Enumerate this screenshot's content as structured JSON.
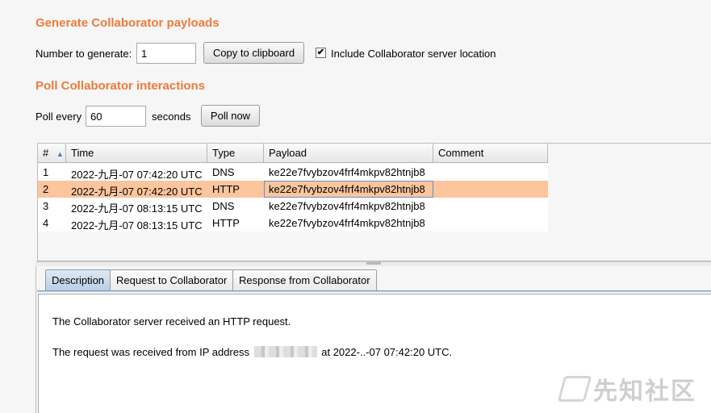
{
  "generate": {
    "heading": "Generate Collaborator payloads",
    "number_label": "Number to generate:",
    "number_value": "1",
    "copy_button": "Copy to clipboard",
    "include_label": "Include Collaborator server location",
    "include_checked": true
  },
  "poll": {
    "heading": "Poll Collaborator interactions",
    "poll_every_label": "Poll every",
    "poll_value": "60",
    "seconds_label": "seconds",
    "poll_now_button": "Poll now"
  },
  "table": {
    "columns": [
      "#",
      "Time",
      "Type",
      "Payload",
      "Comment"
    ],
    "sort_indicator": "▲",
    "rows": [
      {
        "num": "1",
        "time": "2022-九月-07 07:42:20 UTC",
        "type": "DNS",
        "payload": "ke22e7fvybzov4frf4mkpv82htnjb8",
        "comment": ""
      },
      {
        "num": "2",
        "time": "2022-九月-07 07:42:20 UTC",
        "type": "HTTP",
        "payload": "ke22e7fvybzov4frf4mkpv82htnjb8",
        "comment": ""
      },
      {
        "num": "3",
        "time": "2022-九月-07 08:13:15 UTC",
        "type": "DNS",
        "payload": "ke22e7fvybzov4frf4mkpv82htnjb8",
        "comment": ""
      },
      {
        "num": "4",
        "time": "2022-九月-07 08:13:15 UTC",
        "type": "HTTP",
        "payload": "ke22e7fvybzov4frf4mkpv82htnjb8",
        "comment": ""
      }
    ],
    "selected_row": 1
  },
  "tabs": [
    "Description",
    "Request to Collaborator",
    "Response from Collaborator"
  ],
  "description": {
    "line1": "The Collaborator server received an HTTP request.",
    "line2_prefix": "The request was received from IP address",
    "line2_suffix": "at 2022-..-07 07:42:20 UTC."
  },
  "watermark": "先知社区",
  "colors": {
    "accent": "#ee7a3b",
    "selected_row": "#fbc59e",
    "active_tab": "#b9cde4"
  }
}
